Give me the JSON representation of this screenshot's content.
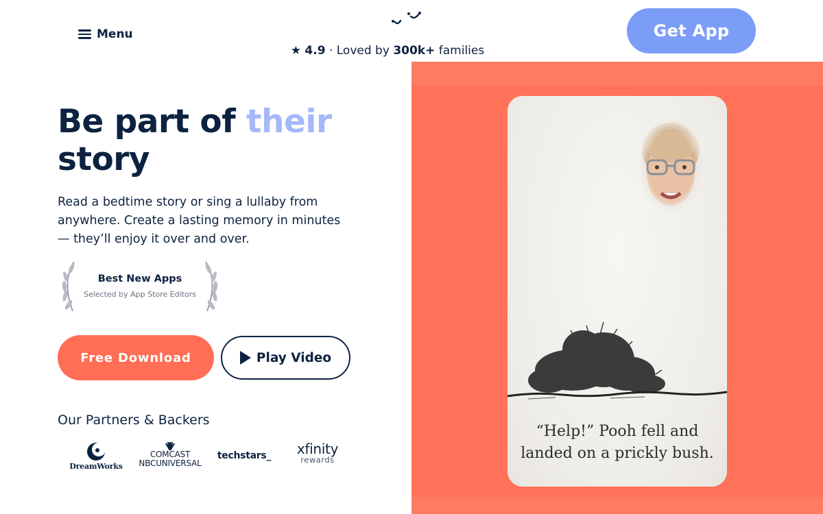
{
  "header": {
    "menu_label": "Menu",
    "rating_star": "★",
    "rating_value": "4.9",
    "rating_mid": "· Loved by",
    "rating_count": "300k+",
    "rating_tail": "families",
    "get_app_label": "Get App"
  },
  "hero": {
    "headline_part1": "Be part of",
    "headline_accent": "their",
    "headline_part2": "story",
    "subtext": "Read a bedtime story or sing a lullaby from anywhere. Create a lasting memory in minutes — they’ll enjoy it over and over.",
    "award_title": "Best New Apps",
    "award_sub": "Selected by App Store Editors",
    "download_label": "Free Download",
    "video_label": "Play Video"
  },
  "partners": {
    "title": "Our Partners & Backers",
    "dreamworks": "DreamWorks",
    "comcast_line1": "COMCAST",
    "comcast_line2": "NBCUNIVERSAL",
    "techstars": "techstars_",
    "xfinity": "xfinity",
    "xfinity_sub": "rewards"
  },
  "story_card": {
    "caption_line1": "“Help!” Pooh fell and",
    "caption_line2": "landed on a prickly bush."
  },
  "colors": {
    "navy": "#0d2240",
    "accent_blue": "#7b9df8",
    "light_blue": "#a6b8f9",
    "coral": "#ff6e55",
    "panel": "#ff7158"
  },
  "icons": {
    "menu": "hamburger-icon",
    "logo": "smile-logo-icon",
    "play": "play-icon",
    "laurel": "laurel-icon"
  }
}
